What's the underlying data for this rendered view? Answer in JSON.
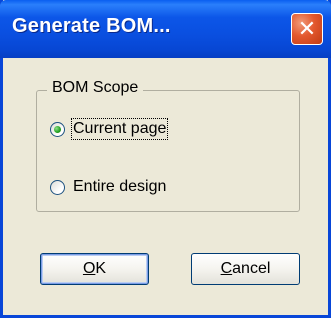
{
  "dialog": {
    "title": "Generate BOM...",
    "close_glyph": "✕",
    "group": {
      "legend": "BOM Scope",
      "options": [
        {
          "label": "Current page",
          "selected": true
        },
        {
          "label": "Entire design",
          "selected": false
        }
      ]
    },
    "buttons": {
      "ok": {
        "mnemonic": "O",
        "rest": "K"
      },
      "cancel": {
        "mnemonic": "C",
        "rest": "ancel"
      }
    }
  },
  "icons": {
    "close": "close-icon"
  },
  "colors": {
    "titlebar": "#0a4fe0",
    "close": "#e3582e",
    "face": "#ece9d8"
  }
}
